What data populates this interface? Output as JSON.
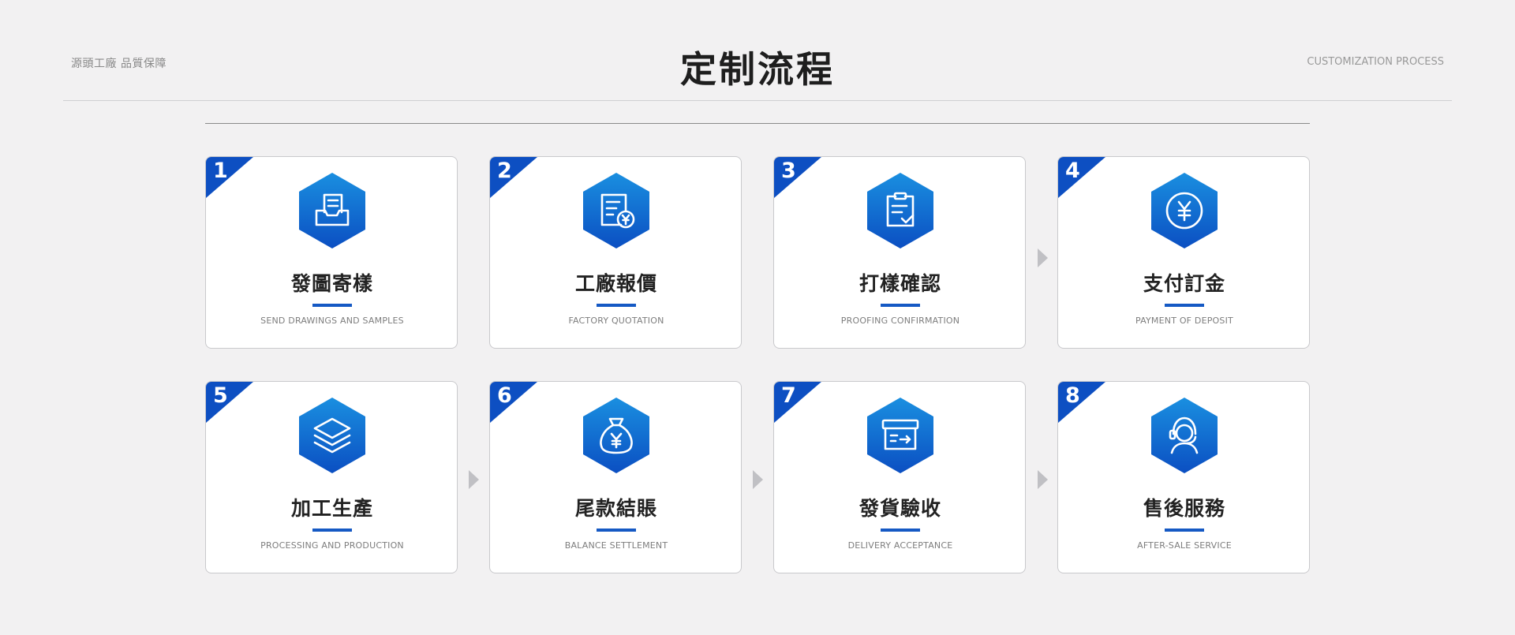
{
  "header": {
    "left_text": "源頭工廠  品質保障",
    "title": "定制流程",
    "right_text": "CUSTOMIZATION PROCESS"
  },
  "colors": {
    "accent": "#1559c4",
    "hex_top": "#1a8fe0",
    "hex_bottom": "#0b4fc2",
    "corner": "#0d4fc2",
    "arrow": "#c0c0c4"
  },
  "steps": [
    {
      "num": "1",
      "title": "發圖寄樣",
      "subtitle": "SEND DRAWINGS AND SAMPLES",
      "icon": "inbox-document-icon"
    },
    {
      "num": "2",
      "title": "工廠報價",
      "subtitle": "FACTORY QUOTATION",
      "icon": "quotation-document-yen-icon"
    },
    {
      "num": "3",
      "title": "打樣確認",
      "subtitle": "PROOFING CONFIRMATION",
      "icon": "clipboard-check-icon"
    },
    {
      "num": "4",
      "title": "支付訂金",
      "subtitle": "PAYMENT OF DEPOSIT",
      "icon": "yen-coin-icon"
    },
    {
      "num": "5",
      "title": "加工生產",
      "subtitle": "PROCESSING AND PRODUCTION",
      "icon": "layers-icon"
    },
    {
      "num": "6",
      "title": "尾款結賬",
      "subtitle": "BALANCE SETTLEMENT",
      "icon": "money-bag-yen-icon"
    },
    {
      "num": "7",
      "title": "發貨驗收",
      "subtitle": "DELIVERY ACCEPTANCE",
      "icon": "delivery-box-icon"
    },
    {
      "num": "8",
      "title": "售後服務",
      "subtitle": "AFTER-SALE SERVICE",
      "icon": "customer-service-headset-icon"
    }
  ]
}
